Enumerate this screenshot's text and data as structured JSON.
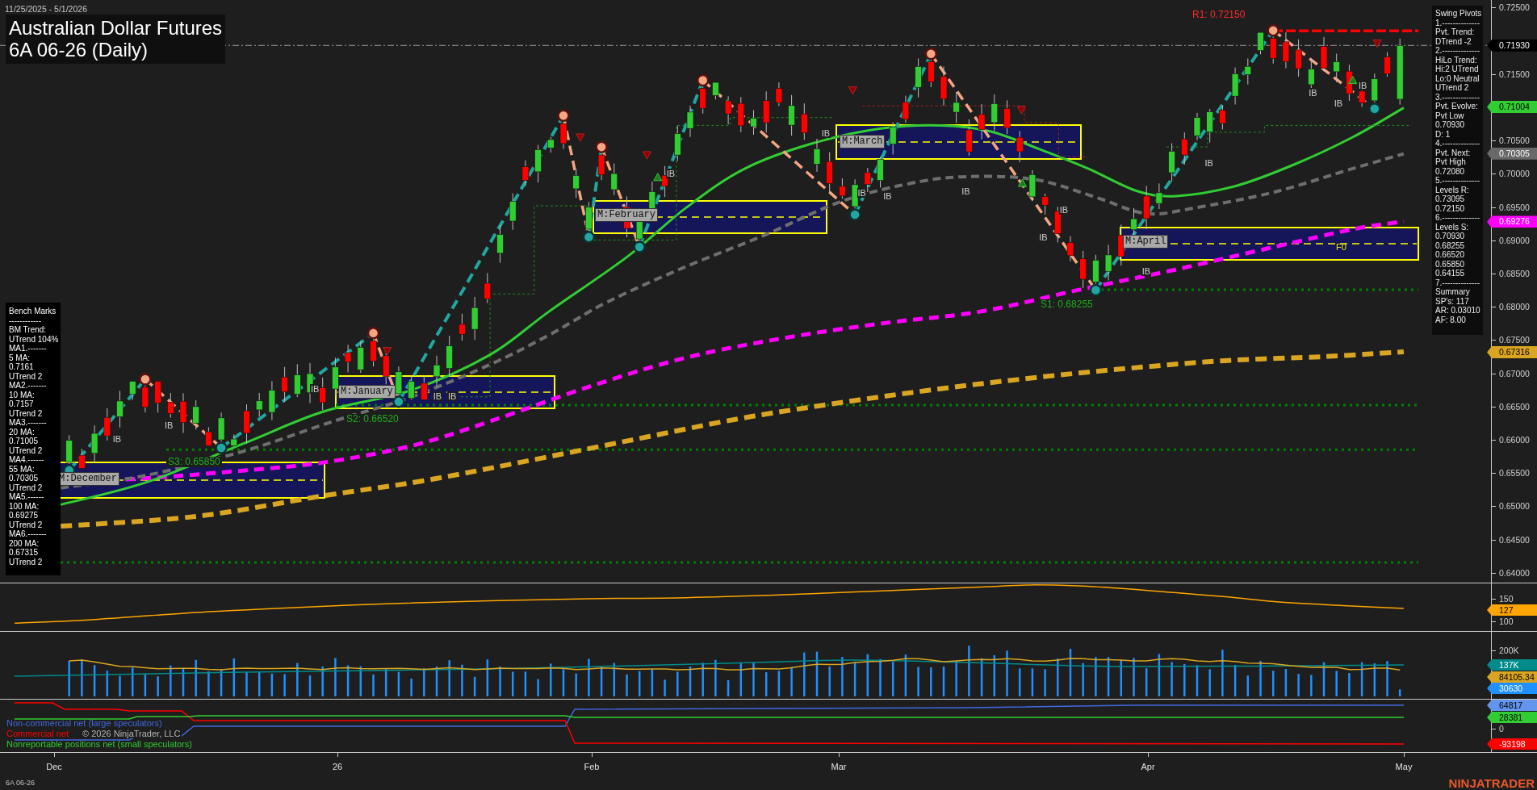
{
  "header": {
    "date_range": "11/25/2025 - 5/1/2026",
    "title": "Australian Dollar Futures",
    "subtitle": "6A 06-26 (Daily)"
  },
  "price_panel": {
    "axis_ticks": [
      "0.72500",
      "0.71500",
      "0.70500",
      "0.70000",
      "0.69500",
      "0.69000",
      "0.68500",
      "0.68000",
      "0.67500",
      "0.67000",
      "0.66500",
      "0.66000",
      "0.65500",
      "0.65000",
      "0.64500",
      "0.64000"
    ],
    "flags": [
      {
        "text": "0.71930",
        "color": "#000000"
      },
      {
        "text": "0.71004",
        "color": "#32cd32"
      },
      {
        "text": "0.70305",
        "color": "#696969"
      },
      {
        "text": "0.69276",
        "color": "#ff00ff"
      },
      {
        "text": "0.67316",
        "color": "#daa520"
      }
    ],
    "levels": [
      {
        "label": "R1: 0.72150",
        "kind": "resistance"
      },
      {
        "label": "S1: 0.68255",
        "kind": "support"
      },
      {
        "label": "S2: 0.66520",
        "kind": "support"
      },
      {
        "label": "S3: 0.65850",
        "kind": "support"
      }
    ],
    "month_labels": [
      "M:December",
      "M:January",
      "M:February",
      "M:March",
      "M:April"
    ],
    "inside_bar_labels": [
      "IB",
      "IB",
      "IB",
      "IB",
      "IB",
      "IB",
      "IB",
      "IB",
      "IB",
      "IB",
      "IB",
      "IB",
      "IB",
      "IB",
      "IB",
      "IB",
      "IB"
    ],
    "box_tag": "F0"
  },
  "benchmarks": {
    "lines": [
      "Bench Marks",
      "------------",
      "BM Trend:",
      "UTrend 104%",
      "MA1.-------",
      "5 MA:",
      "0.7161",
      "UTrend 2",
      "MA2.-------",
      "10 MA:",
      "0.7157",
      "UTrend 2",
      "MA3.-------",
      "20 MA:",
      "0.71005",
      "UTrend 2",
      "MA4.------",
      "55 MA:",
      "0.70305",
      "UTrend 2",
      "MA5.------",
      "100 MA:",
      "0.69275",
      "UTrend 2",
      "MA6.-------",
      "200 MA:",
      "0.67315",
      "UTrend 2"
    ]
  },
  "swing_pivots": {
    "lines": [
      "Swing Pivots",
      "1.--------------",
      "Pvt. Trend:",
      "DTrend -2",
      "2.--------------",
      "HiLo Trend:",
      "Hi:2 UTrend",
      "Lo:0 Neutral",
      "UTrend 2",
      "3.--------------",
      "Pvt. Evolve:",
      "Pvt Low",
      "0.70930",
      "D: 1",
      "4.--------------",
      "Pvt. Next:",
      "Pvt High",
      "0.72080",
      "5.--------------",
      "Levels R:",
      "0.73095",
      "0.72150",
      "6.--------------",
      "Levels S:",
      "0.70930",
      "0.68255",
      "0.66520",
      "0.65850",
      "0.64155",
      "7.--------------",
      "Summary",
      "SP's: 117",
      "AR: 0.03010",
      "AF: 8.00"
    ]
  },
  "oscillator_panel": {
    "axis_ticks": [
      "150",
      "100"
    ],
    "flags": [
      {
        "text": "127",
        "color": "#ffa500"
      }
    ]
  },
  "volume_panel": {
    "axis_ticks": [
      "200K"
    ],
    "flags": [
      {
        "text": "137K",
        "color": "#008b8b"
      },
      {
        "text": "84105.34",
        "color": "#daa520"
      },
      {
        "text": "30630",
        "color": "#1e90ff"
      }
    ]
  },
  "cot_panel": {
    "axis_ticks": [
      "0"
    ],
    "flags": [
      {
        "text": "64817",
        "color": "#6495ed"
      },
      {
        "text": "28381",
        "color": "#32cd32"
      },
      {
        "text": "-93198",
        "color": "#ff0000"
      }
    ],
    "legend": [
      {
        "text": "Non-commercial net (large speculators)",
        "color": "#4169e1"
      },
      {
        "text": "Commercial net",
        "color": "#ff0000"
      },
      {
        "text": "Nonreportable positions net (small speculators)",
        "color": "#32cd32"
      }
    ],
    "copyright": "© 2026 NinjaTrader, LLC"
  },
  "x_axis": {
    "labels": [
      "Dec",
      "26",
      "Feb",
      "Mar",
      "Apr",
      "May"
    ]
  },
  "footer": {
    "instrument": "6A 06-26",
    "brand": "NINJATRADER"
  }
}
